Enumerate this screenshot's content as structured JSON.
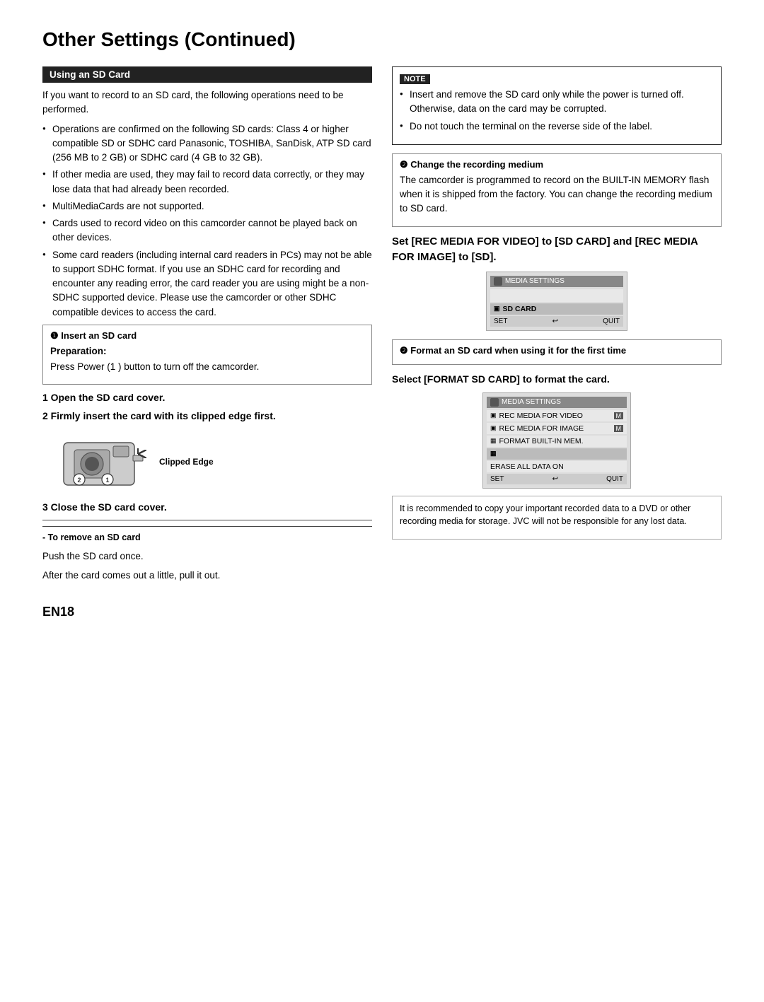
{
  "page": {
    "title": "Other Settings (Continued)",
    "page_number": "EN18"
  },
  "left_col": {
    "section_header": "Using an SD Card",
    "intro": "If you want to record to an SD card, the following operations need to be performed.",
    "bullets": [
      "Operations are confirmed on the following SD cards: Class 4 or higher compatible SD or SDHC card Panasonic, TOSHIBA, SanDisk, ATP SD card (256 MB to 2 GB) or SDHC card (4 GB to 32 GB).",
      "If other media are used, they may fail to record data correctly, or they may lose data that had already been recorded.",
      "MultiMediaCards are not supported.",
      "Cards used to record video on this camcorder cannot be played back on other devices.",
      "Some card readers (including internal card readers in PCs) may not be able to support SDHC format. If you use an SDHC card for recording and encounter any reading error, the card reader you are using might be a non-SDHC supported device. Please use the camcorder or other SDHC compatible devices to access the card."
    ],
    "insert_section": {
      "header": "❶ Insert an SD card",
      "prep_label": "Preparation:",
      "prep_text": "Press Power (1 ) button to turn off the camcorder.",
      "step1": "1",
      "step1_text": "Open the SD card cover.",
      "step2": "2",
      "step2_text": "Firmly insert the card with its clipped edge first.",
      "clipped_edge_label": "Clipped Edge",
      "step3": "3",
      "step3_text": "Close the SD card cover."
    },
    "remove_section": {
      "label": "- To remove an SD card",
      "line1": "Push the SD card once.",
      "line2": "After the card comes out a little, pull it out."
    }
  },
  "right_col": {
    "note_label": "NOTE",
    "note_bullets": [
      "Insert and remove the SD card only while the power is turned off. Otherwise, data on the card may be corrupted.",
      "Do not touch the terminal on the reverse side of the label."
    ],
    "change_medium": {
      "header": "❷ Change the recording medium",
      "text": "The camcorder is programmed to record on the BUILT-IN MEMORY flash when it is shipped from the factory. You can change the recording medium to SD card."
    },
    "set_recs_heading": "Set [REC MEDIA FOR VIDEO] to [SD CARD] and [REC MEDIA FOR IMAGE] to [SD].",
    "screen1": {
      "title": "MEDIA SETTINGS",
      "rows": [
        {
          "label": "SD CARD",
          "selected": true
        }
      ],
      "footer_set": "SET",
      "footer_back": "↩",
      "footer_quit": "QUIT"
    },
    "format_section": {
      "circle": "❷",
      "header": "❷ Format an SD card when using it for the first time",
      "heading2": "Select [FORMAT SD CARD] to format the card.",
      "screen2": {
        "title": "MEDIA SETTINGS",
        "rows": [
          {
            "label": "REC MEDIA FOR VIDEO",
            "badge": "M"
          },
          {
            "label": "REC MEDIA FOR IMAGE",
            "badge": "M"
          },
          {
            "label": "FORMAT BUILT-IN MEM."
          },
          {
            "label": ""
          },
          {
            "label": "ERASE ALL DATA ON"
          }
        ],
        "footer_set": "SET",
        "footer_back": "↩",
        "footer_quit": "QUIT"
      },
      "recommend_text": "It is recommended to copy your important recorded data to a DVD or other recording media for storage. JVC will not be responsible for any lost data."
    }
  }
}
